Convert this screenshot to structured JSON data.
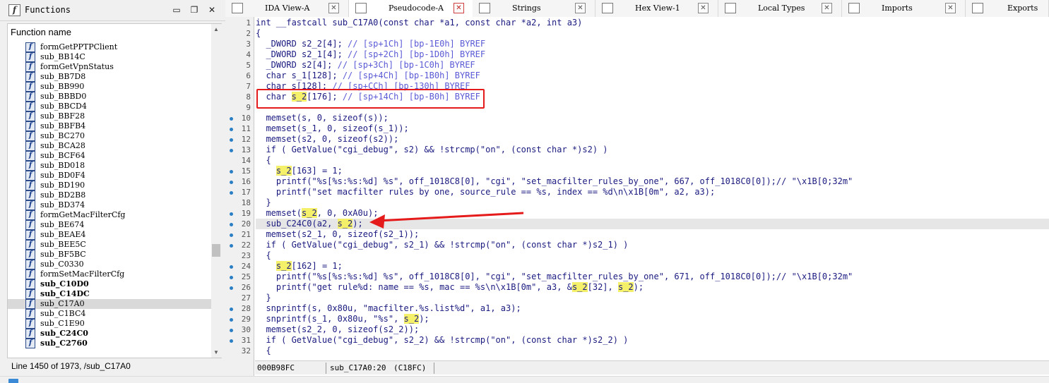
{
  "functions_panel": {
    "title": "Functions",
    "column_header": "Function name",
    "items": [
      {
        "name": "formGetPPTPClient",
        "bold": false
      },
      {
        "name": "sub_BB14C",
        "bold": false
      },
      {
        "name": "formGetVpnStatus",
        "bold": false
      },
      {
        "name": "sub_BB7D8",
        "bold": false
      },
      {
        "name": "sub_BB990",
        "bold": false
      },
      {
        "name": "sub_BBBD0",
        "bold": false
      },
      {
        "name": "sub_BBCD4",
        "bold": false
      },
      {
        "name": "sub_BBF28",
        "bold": false
      },
      {
        "name": "sub_BBFB4",
        "bold": false
      },
      {
        "name": "sub_BC270",
        "bold": false
      },
      {
        "name": "sub_BCA28",
        "bold": false
      },
      {
        "name": "sub_BCF64",
        "bold": false
      },
      {
        "name": "sub_BD018",
        "bold": false
      },
      {
        "name": "sub_BD0F4",
        "bold": false
      },
      {
        "name": "sub_BD190",
        "bold": false
      },
      {
        "name": "sub_BD2B8",
        "bold": false
      },
      {
        "name": "sub_BD374",
        "bold": false
      },
      {
        "name": "formGetMacFilterCfg",
        "bold": false
      },
      {
        "name": "sub_BE674",
        "bold": false
      },
      {
        "name": "sub_BEAE4",
        "bold": false
      },
      {
        "name": "sub_BEE5C",
        "bold": false
      },
      {
        "name": "sub_BF5BC",
        "bold": false
      },
      {
        "name": "sub_C0330",
        "bold": false
      },
      {
        "name": "formSetMacFilterCfg",
        "bold": false
      },
      {
        "name": "sub_C10D0",
        "bold": true
      },
      {
        "name": "sub_C14DC",
        "bold": true
      },
      {
        "name": "sub_C17A0",
        "bold": false,
        "selected": true
      },
      {
        "name": "sub_C1BC4",
        "bold": false
      },
      {
        "name": "sub_C1E90",
        "bold": false
      },
      {
        "name": "sub_C24C0",
        "bold": true
      },
      {
        "name": "sub_C2760",
        "bold": true
      }
    ],
    "status": "Line 1450 of 1973, /sub_C17A0"
  },
  "tabs": [
    {
      "label": "IDA View-A",
      "active": false
    },
    {
      "label": "Pseudocode-A",
      "active": true
    },
    {
      "label": "Strings",
      "active": false
    },
    {
      "label": "Hex View-1",
      "active": false
    },
    {
      "label": "Local Types",
      "active": false
    },
    {
      "label": "Imports",
      "active": false
    },
    {
      "label": "Exports",
      "active": false
    }
  ],
  "code_lines": [
    {
      "n": "1",
      "dot": false,
      "parts": [
        {
          "t": "int __fastcall sub_C17A0(const char *a1, const char *a2, int a3)"
        }
      ]
    },
    {
      "n": "2",
      "dot": false,
      "parts": [
        {
          "t": "{"
        }
      ]
    },
    {
      "n": "3",
      "dot": false,
      "parts": [
        {
          "t": "  _DWORD s2_2[4]; "
        },
        {
          "t": "// [sp+1Ch] [bp-1E0h] BYREF",
          "c": "cmt"
        }
      ]
    },
    {
      "n": "4",
      "dot": false,
      "parts": [
        {
          "t": "  _DWORD s2_1[4]; "
        },
        {
          "t": "// [sp+2Ch] [bp-1D0h] BYREF",
          "c": "cmt"
        }
      ]
    },
    {
      "n": "5",
      "dot": false,
      "parts": [
        {
          "t": "  _DWORD s2[4]; "
        },
        {
          "t": "// [sp+3Ch] [bp-1C0h] BYREF",
          "c": "cmt"
        }
      ]
    },
    {
      "n": "6",
      "dot": false,
      "parts": [
        {
          "t": "  char s_1[128]; "
        },
        {
          "t": "// [sp+4Ch] [bp-1B0h] BYREF",
          "c": "cmt"
        }
      ]
    },
    {
      "n": "7",
      "dot": false,
      "parts": [
        {
          "t": "  char s[128]; "
        },
        {
          "t": "// [sp+CCh] [bp-130h] BYREF",
          "c": "cmt"
        }
      ]
    },
    {
      "n": "8",
      "dot": false,
      "parts": [
        {
          "t": "  char "
        },
        {
          "t": "s_2",
          "c": "hl"
        },
        {
          "t": "[176]; "
        },
        {
          "t": "// [sp+14Ch] [bp-B0h] BYREF",
          "c": "cmt"
        }
      ]
    },
    {
      "n": "9",
      "dot": false,
      "parts": [
        {
          "t": ""
        }
      ]
    },
    {
      "n": "10",
      "dot": true,
      "parts": [
        {
          "t": "  memset(s, 0, sizeof(s));"
        }
      ]
    },
    {
      "n": "11",
      "dot": true,
      "parts": [
        {
          "t": "  memset(s_1, 0, sizeof(s_1));"
        }
      ]
    },
    {
      "n": "12",
      "dot": true,
      "parts": [
        {
          "t": "  memset(s2, 0, sizeof(s2));"
        }
      ]
    },
    {
      "n": "13",
      "dot": true,
      "parts": [
        {
          "t": "  if ( GetValue(\"cgi_debug\", s2) && !strcmp(\"on\", (const char *)s2) )"
        }
      ]
    },
    {
      "n": "14",
      "dot": false,
      "parts": [
        {
          "t": "  {"
        }
      ]
    },
    {
      "n": "15",
      "dot": true,
      "parts": [
        {
          "t": "    "
        },
        {
          "t": "s_2",
          "c": "hl"
        },
        {
          "t": "[163] = 1;"
        }
      ]
    },
    {
      "n": "16",
      "dot": true,
      "parts": [
        {
          "t": "    printf(\"%s[%s:%s:%d] %s\", off_1018C8[0], \"cgi\", \"set_macfilter_rules_by_one\", 667, off_1018C0[0]);// \"\\x1B[0;32m\""
        }
      ]
    },
    {
      "n": "17",
      "dot": true,
      "parts": [
        {
          "t": "    printf(\"set macfilter rules by one, source_rule == %s, index == %d\\n\\x1B[0m\", a2, a3);"
        }
      ]
    },
    {
      "n": "18",
      "dot": false,
      "parts": [
        {
          "t": "  }"
        }
      ]
    },
    {
      "n": "19",
      "dot": true,
      "parts": [
        {
          "t": "  memset("
        },
        {
          "t": "s_2",
          "c": "hl"
        },
        {
          "t": ", 0, 0xA0u);"
        }
      ]
    },
    {
      "n": "20",
      "dot": true,
      "cur": true,
      "parts": [
        {
          "t": "  sub_C24C0(a2, "
        },
        {
          "t": "s_2",
          "c": "hl"
        },
        {
          "t": ");"
        }
      ]
    },
    {
      "n": "21",
      "dot": true,
      "parts": [
        {
          "t": "  memset(s2_1, 0, sizeof(s2_1));"
        }
      ]
    },
    {
      "n": "22",
      "dot": true,
      "parts": [
        {
          "t": "  if ( GetValue(\"cgi_debug\", s2_1) && !strcmp(\"on\", (const char *)s2_1) )"
        }
      ]
    },
    {
      "n": "23",
      "dot": false,
      "parts": [
        {
          "t": "  {"
        }
      ]
    },
    {
      "n": "24",
      "dot": true,
      "parts": [
        {
          "t": "    "
        },
        {
          "t": "s_2",
          "c": "hl"
        },
        {
          "t": "[162] = 1;"
        }
      ]
    },
    {
      "n": "25",
      "dot": true,
      "parts": [
        {
          "t": "    printf(\"%s[%s:%s:%d] %s\", off_1018C8[0], \"cgi\", \"set_macfilter_rules_by_one\", 671, off_1018C0[0]);// \"\\x1B[0;32m\""
        }
      ]
    },
    {
      "n": "26",
      "dot": true,
      "parts": [
        {
          "t": "    printf(\"get rule%d: name == %s, mac == %s\\n\\x1B[0m\", a3, &"
        },
        {
          "t": "s_2",
          "c": "hl"
        },
        {
          "t": "[32], "
        },
        {
          "t": "s_2",
          "c": "hl"
        },
        {
          "t": ");"
        }
      ]
    },
    {
      "n": "27",
      "dot": false,
      "parts": [
        {
          "t": "  }"
        }
      ]
    },
    {
      "n": "28",
      "dot": true,
      "parts": [
        {
          "t": "  snprintf(s, 0x80u, \"macfilter.%s.list%d\", a1, a3);"
        }
      ]
    },
    {
      "n": "29",
      "dot": true,
      "parts": [
        {
          "t": "  snprintf(s_1, 0x80u, \"%s\", "
        },
        {
          "t": "s_2",
          "c": "hl"
        },
        {
          "t": ");"
        }
      ]
    },
    {
      "n": "30",
      "dot": true,
      "parts": [
        {
          "t": "  memset(s2_2, 0, sizeof(s2_2));"
        }
      ]
    },
    {
      "n": "31",
      "dot": true,
      "parts": [
        {
          "t": "  if ( GetValue(\"cgi_debug\", s2_2) && !strcmp(\"on\", (const char *)s2_2) )"
        }
      ]
    },
    {
      "n": "32",
      "dot": false,
      "parts": [
        {
          "t": "  {"
        }
      ]
    }
  ],
  "code_status": {
    "address": "000B98FC",
    "location": "sub_C17A0:20",
    "offset": "(C18FC)"
  }
}
